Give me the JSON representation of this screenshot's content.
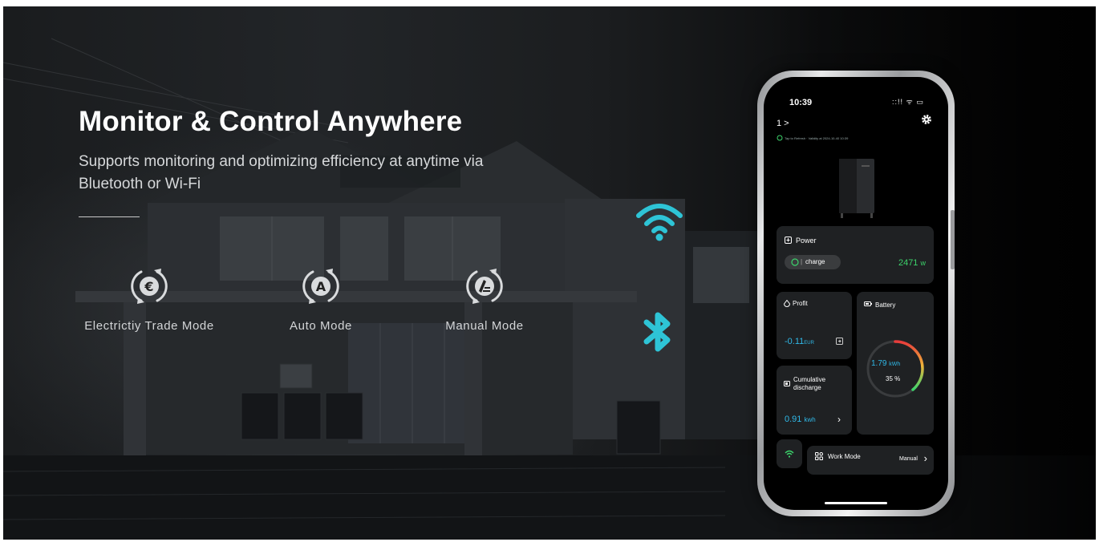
{
  "hero": {
    "title": "Monitor & Control Anywhere",
    "subtitle": "Supports monitoring and optimizing efficiency at anytime via Bluetooth or Wi-Fi"
  },
  "modes": [
    {
      "label": "Electrictiy Trade Mode",
      "icon": "euro-cycle-icon"
    },
    {
      "label": "Auto Mode",
      "icon": "auto-cycle-icon"
    },
    {
      "label": "Manual Mode",
      "icon": "manual-cycle-icon"
    }
  ],
  "connectivity": {
    "wifi_icon": "wifi-icon",
    "bluetooth_icon": "bluetooth-icon",
    "accent": "#2ec4d6"
  },
  "phone": {
    "status_time": "10:39",
    "status_icons": "::!! ᯤ ▭",
    "device_name": "1 >",
    "tiny_line": "Tap to Refresh · Validity at 2024-10-40 10:39",
    "power": {
      "title": "Power",
      "state": "charge",
      "value": "2471",
      "unit": "w"
    },
    "profit": {
      "title": "Profit",
      "value": "-0.11",
      "unit": "EUR"
    },
    "battery": {
      "title": "Battery",
      "energy": "1.79",
      "energy_unit": "kWh",
      "percent": "35 %",
      "level": 0.35
    },
    "cumulative": {
      "title_line1": "Cumulative",
      "title_line2": "discharge",
      "value": "0.91",
      "unit": "kwh"
    },
    "work_mode": {
      "label": "Work Mode",
      "value": "Manual"
    },
    "colors": {
      "accent_green": "#3cd36b",
      "accent_cyan": "#30b9e8",
      "card_bg": "#1f2123"
    }
  }
}
